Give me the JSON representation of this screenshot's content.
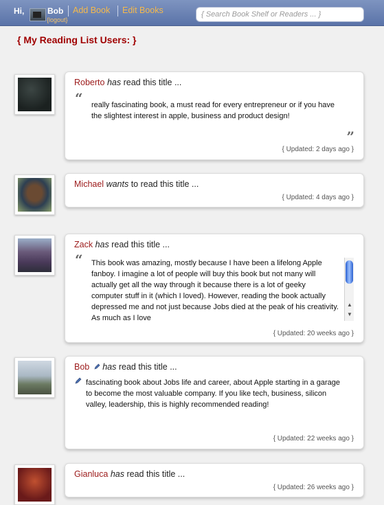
{
  "topbar": {
    "greeting": "Hi,",
    "username": "Bob",
    "logout": "{logout}",
    "nav": [
      "Add Book",
      "Edit Books"
    ],
    "search_placeholder": "{ Search Book Shelf or Readers ... }"
  },
  "page_title": "{ My Reading List Users: }",
  "entries": [
    {
      "name": "Roberto",
      "verb": "has",
      "rest": " read this title ...",
      "review": "really fascinating book, a must read for every entrepreneur or if you have the slightest interest in apple, business and product design!",
      "updated": "{ Updated: 2 days ago }"
    },
    {
      "name": "Michael",
      "verb": "wants",
      "rest": " to read this title ...",
      "updated": "{ Updated: 4 days ago }"
    },
    {
      "name": "Zack",
      "verb": "has",
      "rest": " read this title ...",
      "review": "This book was amazing, mostly because I have been a lifelong Apple fanboy. I imagine a lot of people will buy this book but not many will actually get all the way through it because there is a lot of geeky computer stuff in it (which I loved). However, reading the book actually depressed me and not just because Jobs died at the peak of his creativity. As much as I love",
      "updated": "{ Updated: 20 weeks ago }"
    },
    {
      "name": "Bob",
      "verb": "has",
      "rest": " read this title ...",
      "review": "fascinating book about Jobs life and career, about Apple starting in a garage to become the most valuable company. If you like tech, business, silicon valley, leadership, this is highly recommended reading!",
      "updated": "{ Updated: 22 weeks ago }"
    },
    {
      "name": "Gianluca",
      "verb": "has",
      "rest": " read this title ...",
      "updated": "{ Updated: 26 weeks ago }"
    }
  ],
  "icons": {
    "quote_open": "“",
    "quote_close": "”"
  },
  "colors": {
    "topbar": "#6a82b4",
    "link_orange": "#f5b94c",
    "name_red": "#9c1a1a",
    "title_red": "#a00000"
  }
}
